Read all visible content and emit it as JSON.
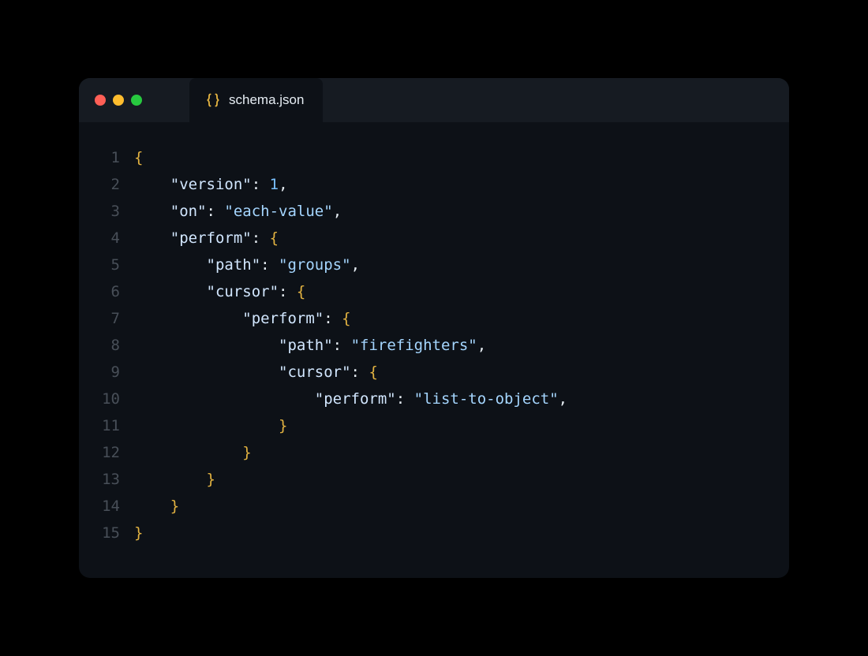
{
  "tab": {
    "filename": "schema.json",
    "icon": "braces-icon",
    "icon_color": "#e3b341"
  },
  "colors": {
    "brace": "#e3b341",
    "key": "#d2e7ff",
    "string": "#a5d6ff",
    "number": "#79c0ff",
    "punct": "#e6edf3",
    "gutter": "#484f58",
    "bg": "#0d1117",
    "titlebar": "#161b22"
  },
  "gutter": [
    "1",
    "2",
    "3",
    "4",
    "5",
    "6",
    "7",
    "8",
    "9",
    "10",
    "11",
    "12",
    "13",
    "14",
    "15"
  ],
  "code_lines": [
    [
      {
        "t": "{",
        "c": "br"
      }
    ],
    [
      {
        "t": "    ",
        "c": "p"
      },
      {
        "t": "\"version\"",
        "c": "k"
      },
      {
        "t": ": ",
        "c": "p"
      },
      {
        "t": "1",
        "c": "n"
      },
      {
        "t": ",",
        "c": "p"
      }
    ],
    [
      {
        "t": "    ",
        "c": "p"
      },
      {
        "t": "\"on\"",
        "c": "k"
      },
      {
        "t": ": ",
        "c": "p"
      },
      {
        "t": "\"each-value\"",
        "c": "s"
      },
      {
        "t": ",",
        "c": "p"
      }
    ],
    [
      {
        "t": "    ",
        "c": "p"
      },
      {
        "t": "\"perform\"",
        "c": "k"
      },
      {
        "t": ": ",
        "c": "p"
      },
      {
        "t": "{",
        "c": "br"
      }
    ],
    [
      {
        "t": "        ",
        "c": "p"
      },
      {
        "t": "\"path\"",
        "c": "k"
      },
      {
        "t": ": ",
        "c": "p"
      },
      {
        "t": "\"groups\"",
        "c": "s"
      },
      {
        "t": ",",
        "c": "p"
      }
    ],
    [
      {
        "t": "        ",
        "c": "p"
      },
      {
        "t": "\"cursor\"",
        "c": "k"
      },
      {
        "t": ": ",
        "c": "p"
      },
      {
        "t": "{",
        "c": "br"
      }
    ],
    [
      {
        "t": "            ",
        "c": "p"
      },
      {
        "t": "\"perform\"",
        "c": "k"
      },
      {
        "t": ": ",
        "c": "p"
      },
      {
        "t": "{",
        "c": "br"
      }
    ],
    [
      {
        "t": "                ",
        "c": "p"
      },
      {
        "t": "\"path\"",
        "c": "k"
      },
      {
        "t": ": ",
        "c": "p"
      },
      {
        "t": "\"firefighters\"",
        "c": "s"
      },
      {
        "t": ",",
        "c": "p"
      }
    ],
    [
      {
        "t": "                ",
        "c": "p"
      },
      {
        "t": "\"cursor\"",
        "c": "k"
      },
      {
        "t": ": ",
        "c": "p"
      },
      {
        "t": "{",
        "c": "br"
      }
    ],
    [
      {
        "t": "                    ",
        "c": "p"
      },
      {
        "t": "\"perform\"",
        "c": "k"
      },
      {
        "t": ": ",
        "c": "p"
      },
      {
        "t": "\"list-to-object\"",
        "c": "s"
      },
      {
        "t": ",",
        "c": "p"
      }
    ],
    [
      {
        "t": "                ",
        "c": "p"
      },
      {
        "t": "}",
        "c": "br"
      }
    ],
    [
      {
        "t": "            ",
        "c": "p"
      },
      {
        "t": "}",
        "c": "br"
      }
    ],
    [
      {
        "t": "        ",
        "c": "p"
      },
      {
        "t": "}",
        "c": "br"
      }
    ],
    [
      {
        "t": "    ",
        "c": "p"
      },
      {
        "t": "}",
        "c": "br"
      }
    ],
    [
      {
        "t": "}",
        "c": "br"
      }
    ]
  ]
}
